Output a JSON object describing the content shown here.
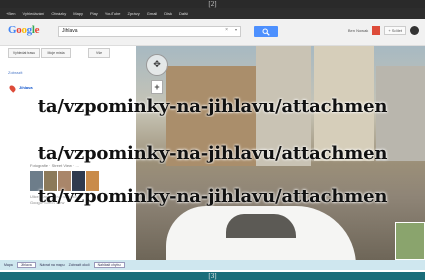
{
  "page_labels": {
    "top": "[2]",
    "bottom": "[3]"
  },
  "gbar": {
    "items": [
      "+Ben",
      "Vyhledávání",
      "Obrázky",
      "Mapy",
      "Play",
      "YouTube",
      "Zprávy",
      "Gmail",
      "Disk",
      "Další"
    ]
  },
  "header": {
    "logo": "Google",
    "search_value": "Jihlava",
    "search_clear": "×",
    "search_dropdown": "▾",
    "user_name": "Ben Nowak",
    "share_label": "+ Sdílet"
  },
  "subbar": {
    "button1": "Vyhledat trasu",
    "button2": "Moje místa",
    "button3": "Vše"
  },
  "panel": {
    "small_link": "Zobrazit",
    "place_title": "Jihlava",
    "photos_label": "Fotografie · Street View · ...",
    "credit_line1": "Ulice Masarykovo náměstí",
    "credit_line2": "Google Street View"
  },
  "street": {
    "compass_glyph": "✥",
    "zoom_glyph": "+"
  },
  "statusbar": {
    "label1": "Mapa",
    "search_box": "Jihlava",
    "label2": "Návrat na mapu",
    "label3": "Zobrazit okolí",
    "label4": "Nahlásit chybu"
  },
  "overlay": {
    "text": "ta/vzpominky-na-jihlavu/attachmen"
  },
  "colors": {
    "accent": "#4d90fe",
    "notification": "#dd4b39",
    "statusbar": "#cfe7ef"
  }
}
